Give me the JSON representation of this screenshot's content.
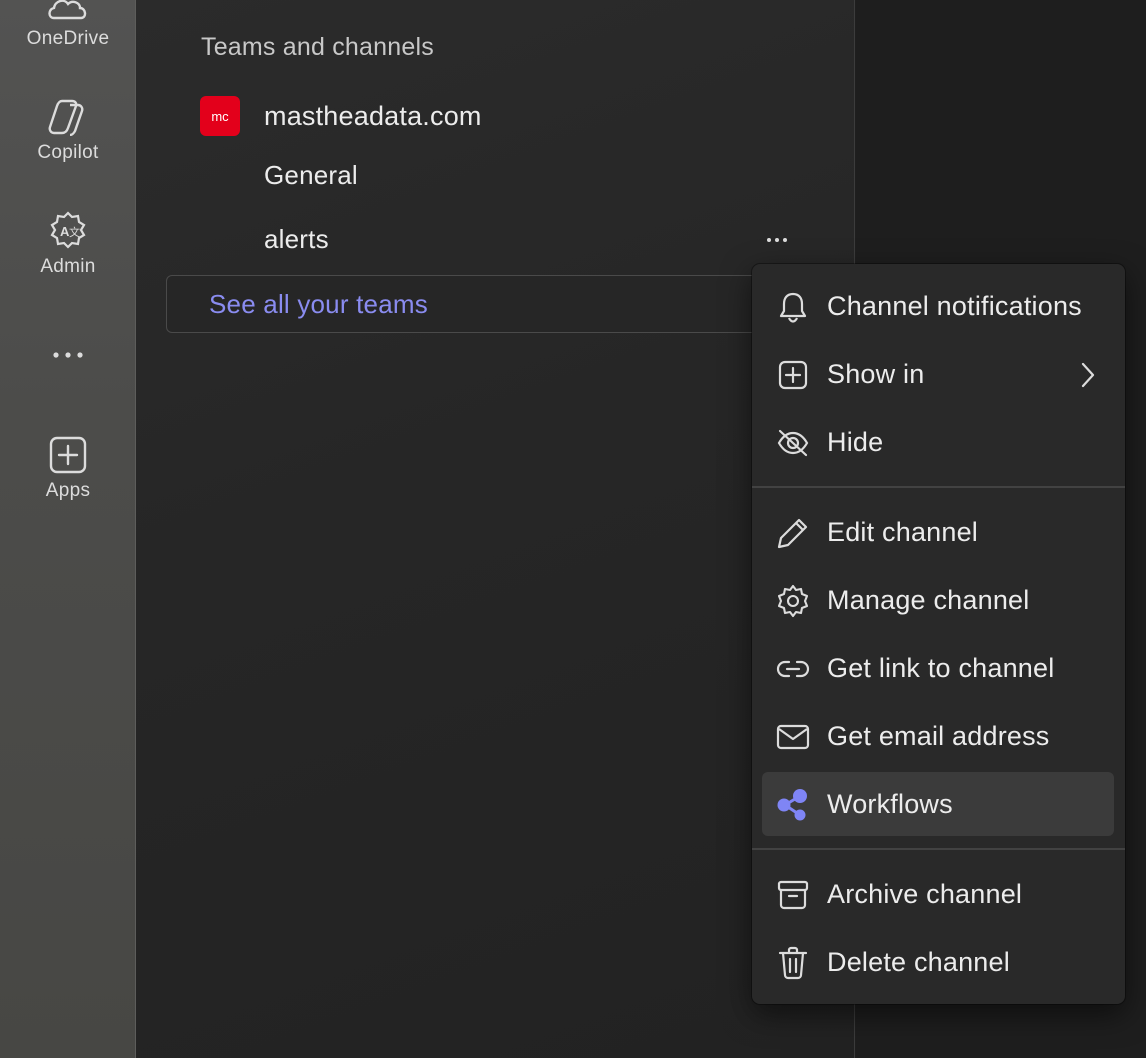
{
  "rail": {
    "items": [
      {
        "label": "OneDrive",
        "icon": "cloud-icon"
      },
      {
        "label": "Copilot",
        "icon": "copilot-icon"
      },
      {
        "label": "Admin",
        "icon": "admin-gear-icon"
      },
      {
        "label": "",
        "icon": "more-horizontal-icon"
      },
      {
        "label": "Apps",
        "icon": "add-square-icon"
      }
    ]
  },
  "panel": {
    "section_title": "Teams and channels",
    "team": {
      "avatar_text": "mc",
      "name": "mastheadata.com",
      "avatar_color": "#e3001b"
    },
    "channels": [
      "General",
      "alerts"
    ],
    "see_all_label": "See all your teams"
  },
  "context_menu": {
    "items": [
      {
        "label": "Channel notifications",
        "icon": "bell-icon"
      },
      {
        "label": "Show in",
        "icon": "add-square-icon",
        "has_submenu": true
      },
      {
        "label": "Hide",
        "icon": "eye-off-icon"
      },
      {
        "label": "Edit channel",
        "icon": "pencil-icon"
      },
      {
        "label": "Manage channel",
        "icon": "gear-icon"
      },
      {
        "label": "Get link to channel",
        "icon": "link-icon"
      },
      {
        "label": "Get email address",
        "icon": "mail-icon"
      },
      {
        "label": "Workflows",
        "icon": "workflows-icon",
        "highlighted": true
      },
      {
        "label": "Archive channel",
        "icon": "archive-icon"
      },
      {
        "label": "Delete channel",
        "icon": "trash-icon"
      }
    ]
  },
  "colors": {
    "accent": "#8a8cf0",
    "workflows_icon": "#7f85f5",
    "menu_bg": "#292929"
  }
}
